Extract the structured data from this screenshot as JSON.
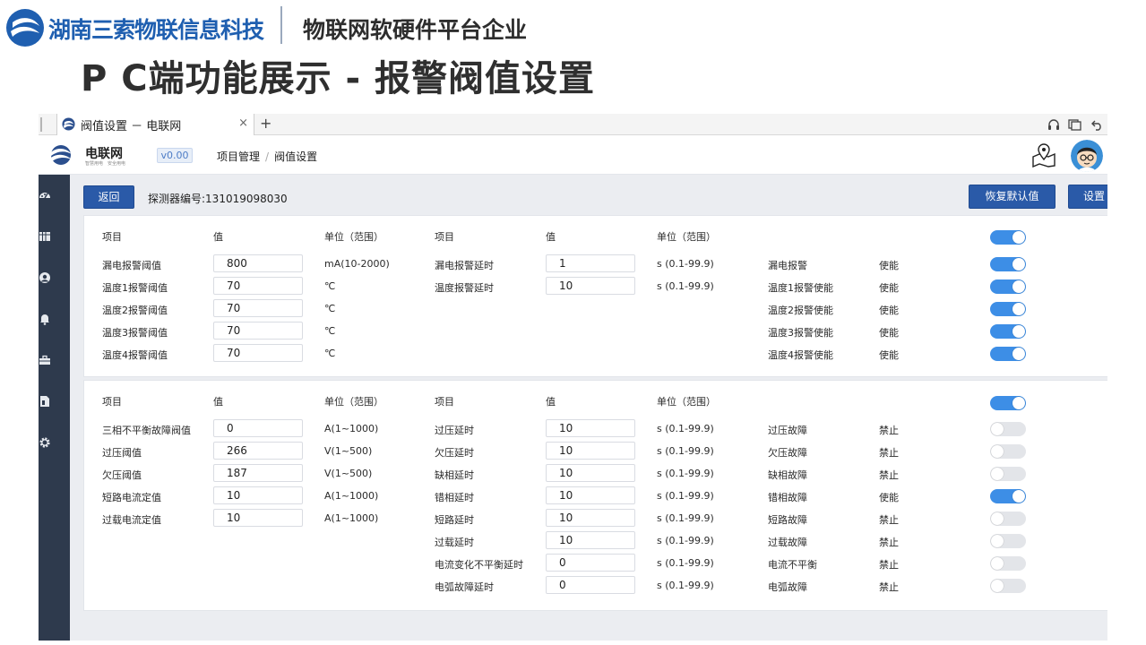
{
  "slide": {
    "brand_name": "湖南三索物联信息科技",
    "brand_tagline": "物联网软硬件平台企业",
    "title": "P C端功能展示 - 报警阀值设置"
  },
  "browser": {
    "tab_title": "阀值设置 － 电联网",
    "tab_close": "×",
    "new_tab": "+"
  },
  "app": {
    "name": "电联网",
    "slogan": "智慧用电　安全用电",
    "version": "v0.00",
    "breadcrumb": [
      "项目管理",
      "阀值设置"
    ]
  },
  "toolbar": {
    "back_label": "返回",
    "device_label": "探测器编号:131019098030",
    "restore_label": "恢复默认值",
    "set_label": "设置"
  },
  "panel1": {
    "headers": [
      "项目",
      "值",
      "单位（范围）",
      "项目",
      "值",
      "单位（范围）"
    ],
    "header_toggle": true,
    "left_rows": [
      {
        "label": "漏电报警阈值",
        "value": "800",
        "unit": "mA(10-2000)"
      },
      {
        "label": "温度1报警阈值",
        "value": "70",
        "unit": "℃"
      },
      {
        "label": "温度2报警阈值",
        "value": "70",
        "unit": "℃"
      },
      {
        "label": "温度3报警阈值",
        "value": "70",
        "unit": "℃"
      },
      {
        "label": "温度4报警阈值",
        "value": "70",
        "unit": "℃"
      }
    ],
    "mid_rows": [
      {
        "label": "漏电报警延时",
        "value": "1",
        "unit": "s (0.1-99.9)"
      },
      {
        "label": "温度报警延时",
        "value": "10",
        "unit": "s (0.1-99.9)"
      }
    ],
    "right_rows": [
      {
        "label": "漏电报警",
        "status": "使能",
        "on": true
      },
      {
        "label": "温度1报警使能",
        "status": "使能",
        "on": true
      },
      {
        "label": "温度2报警使能",
        "status": "使能",
        "on": true
      },
      {
        "label": "温度3报警使能",
        "status": "使能",
        "on": true
      },
      {
        "label": "温度4报警使能",
        "status": "使能",
        "on": true
      }
    ]
  },
  "panel2": {
    "headers": [
      "项目",
      "值",
      "单位（范围）",
      "项目",
      "值",
      "单位（范围）"
    ],
    "header_toggle": true,
    "left_rows": [
      {
        "label": "三相不平衡故障阀值",
        "value": "0",
        "unit": "A(1~1000)"
      },
      {
        "label": "过压阈值",
        "value": "266",
        "unit": "V(1~500)"
      },
      {
        "label": "欠压阈值",
        "value": "187",
        "unit": "V(1~500)"
      },
      {
        "label": "短路电流定值",
        "value": "10",
        "unit": "A(1~1000)"
      },
      {
        "label": "过载电流定值",
        "value": "10",
        "unit": "A(1~1000)"
      }
    ],
    "mid_rows": [
      {
        "label": "过压延时",
        "value": "10",
        "unit": "s (0.1-99.9)"
      },
      {
        "label": "欠压延时",
        "value": "10",
        "unit": "s (0.1-99.9)"
      },
      {
        "label": "缺相延时",
        "value": "10",
        "unit": "s (0.1-99.9)"
      },
      {
        "label": "错相延时",
        "value": "10",
        "unit": "s (0.1-99.9)"
      },
      {
        "label": "短路延时",
        "value": "10",
        "unit": "s (0.1-99.9)"
      },
      {
        "label": "过载延时",
        "value": "10",
        "unit": "s (0.1-99.9)"
      },
      {
        "label": "电流变化不平衡延时",
        "value": "0",
        "unit": "s (0.1-99.9)"
      },
      {
        "label": "电弧故障延时",
        "value": "0",
        "unit": "s (0.1-99.9)"
      }
    ],
    "right_rows": [
      {
        "label": "过压故障",
        "status": "禁止",
        "on": false
      },
      {
        "label": "欠压故障",
        "status": "禁止",
        "on": false
      },
      {
        "label": "缺相故障",
        "status": "禁止",
        "on": false
      },
      {
        "label": "错相故障",
        "status": "使能",
        "on": true
      },
      {
        "label": "短路故障",
        "status": "禁止",
        "on": false
      },
      {
        "label": "过载故障",
        "status": "禁止",
        "on": false
      },
      {
        "label": "电流不平衡",
        "status": "禁止",
        "on": false
      },
      {
        "label": "电弧故障",
        "status": "禁止",
        "on": false
      }
    ]
  },
  "colors": {
    "accent": "#2a5aa8",
    "toggle_on": "#3d8ee6",
    "toggle_off": "#e3e5e9",
    "sidebar": "#2e3a4d"
  },
  "icons": {
    "sidebar": [
      "dashboard-icon",
      "grid-icon",
      "user-icon",
      "bell-icon",
      "toolbox-icon",
      "document-icon",
      "gear-icon"
    ]
  }
}
